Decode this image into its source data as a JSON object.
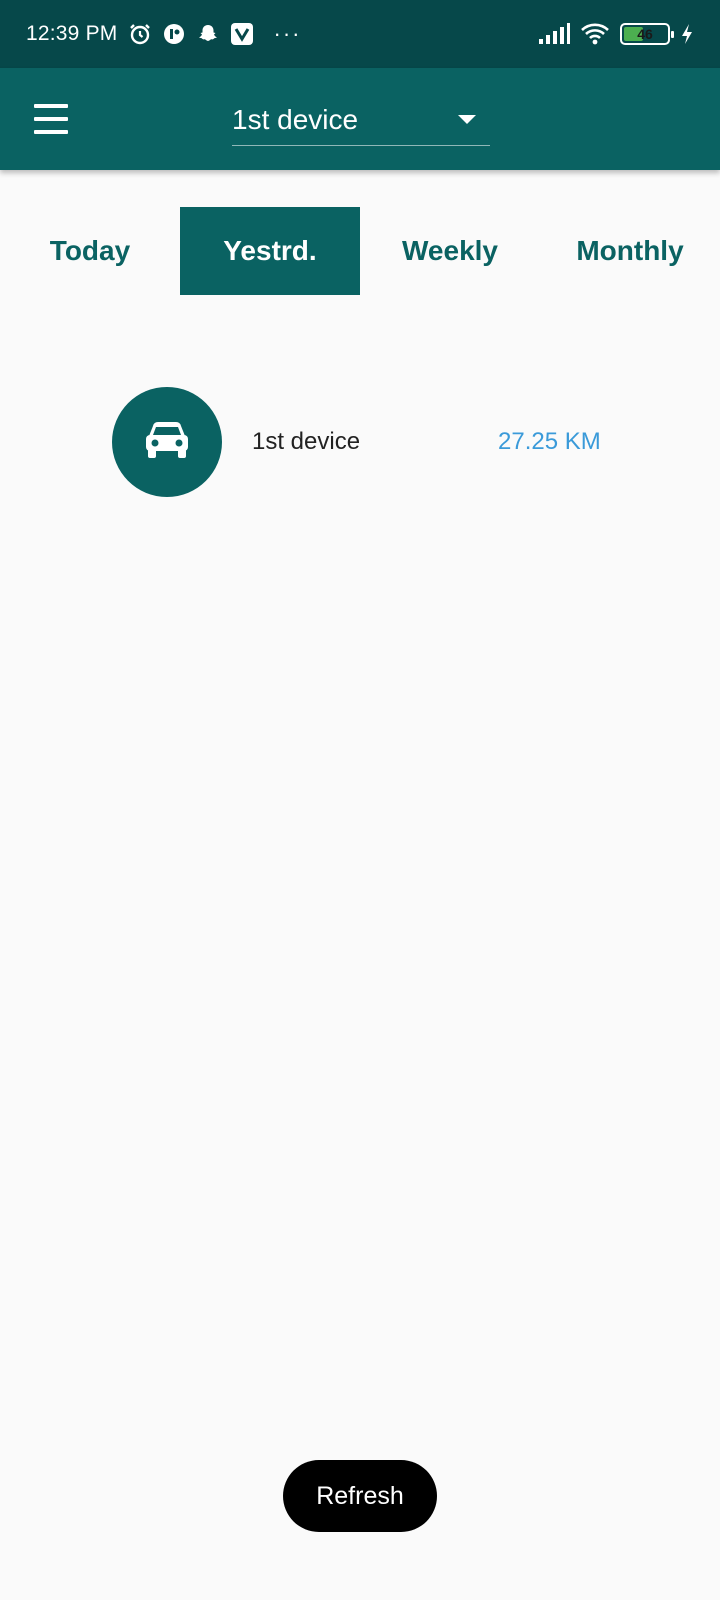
{
  "status_bar": {
    "time": "12:39 PM",
    "left_icons": [
      "alarm-icon",
      "app-icon",
      "snapchat-icon",
      "vivaldi-icon"
    ],
    "more": "···",
    "battery_level": "46",
    "battery_fraction": 0.46,
    "right_icons": [
      "signal-icon",
      "wifi-icon",
      "battery-icon",
      "charging-icon"
    ]
  },
  "app_bar": {
    "selected_device": "1st device",
    "bg_color": "#0a6262"
  },
  "tabs": [
    {
      "label": "Today",
      "active": false
    },
    {
      "label": "Yestrd.",
      "active": true
    },
    {
      "label": "Weekly",
      "active": false
    },
    {
      "label": "Monthly",
      "active": false
    }
  ],
  "devices": [
    {
      "name": "1st device",
      "distance": "27.25 KM",
      "icon": "car-icon"
    }
  ],
  "refresh_label": "Refresh",
  "colors": {
    "accent": "#0a6262",
    "status_bar": "#06484a",
    "distance": "#3a9ad9"
  }
}
